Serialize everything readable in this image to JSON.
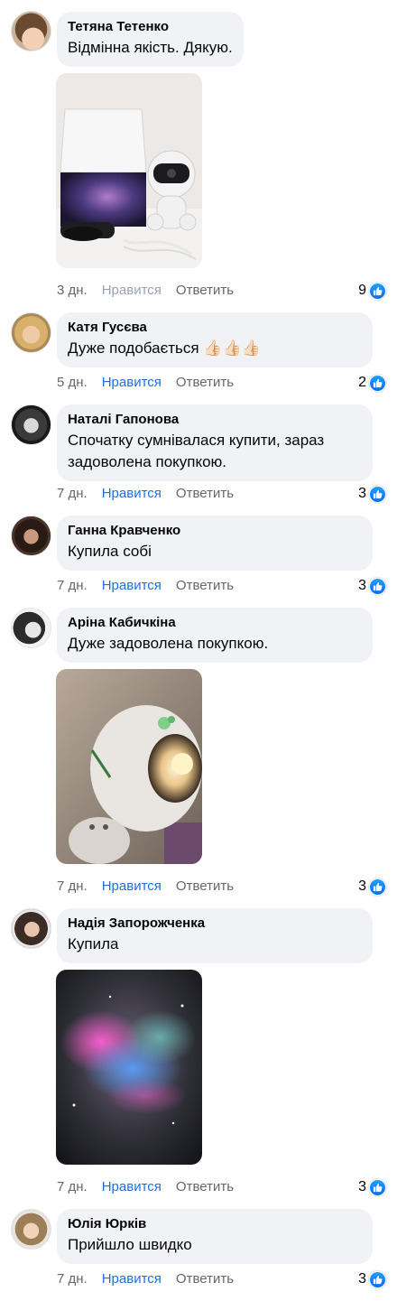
{
  "comments": [
    {
      "author": "Тетяна Тетенко",
      "text": "Відмінна якість. Дякую.",
      "time": "3 дн.",
      "like_label": "Нравится",
      "reply_label": "Ответить",
      "reaction_count": "9"
    },
    {
      "author": "Катя Гусєва",
      "text": "Дуже подобається 👍🏻👍🏻👍🏻",
      "time": "5 дн.",
      "like_label": "Нравится",
      "reply_label": "Ответить",
      "reaction_count": "2"
    },
    {
      "author": "Наталі Гапонова",
      "text": "Спочатку сумнівалася купити, зараз задоволена покупкою.",
      "time": "7 дн.",
      "like_label": "Нравится",
      "reply_label": "Ответить",
      "reaction_count": "3"
    },
    {
      "author": "Ганна Кравченко",
      "text": "Купила собі",
      "time": "7 дн.",
      "like_label": "Нравится",
      "reply_label": "Ответить",
      "reaction_count": "3"
    },
    {
      "author": "Аріна Кабичкіна",
      "text": "Дуже задоволена покупкою.",
      "time": "7 дн.",
      "like_label": "Нравится",
      "reply_label": "Ответить",
      "reaction_count": "3"
    },
    {
      "author": "Надія Запорожченка",
      "text": "Купила",
      "time": "7 дн.",
      "like_label": "Нравится",
      "reply_label": "Ответить",
      "reaction_count": "3"
    },
    {
      "author": "Юлія Юрків",
      "text": "Прийшло швидко",
      "time": "7 дн.",
      "like_label": "Нравится",
      "reply_label": "Ответить",
      "reaction_count": "3"
    }
  ],
  "colors": {
    "bubble": "#f0f2f5",
    "link_blue": "#216fdb",
    "meta_gray": "#65676b",
    "reaction_blue": "#1877f2"
  },
  "icons": {
    "reaction": "like-thumb-icon"
  }
}
